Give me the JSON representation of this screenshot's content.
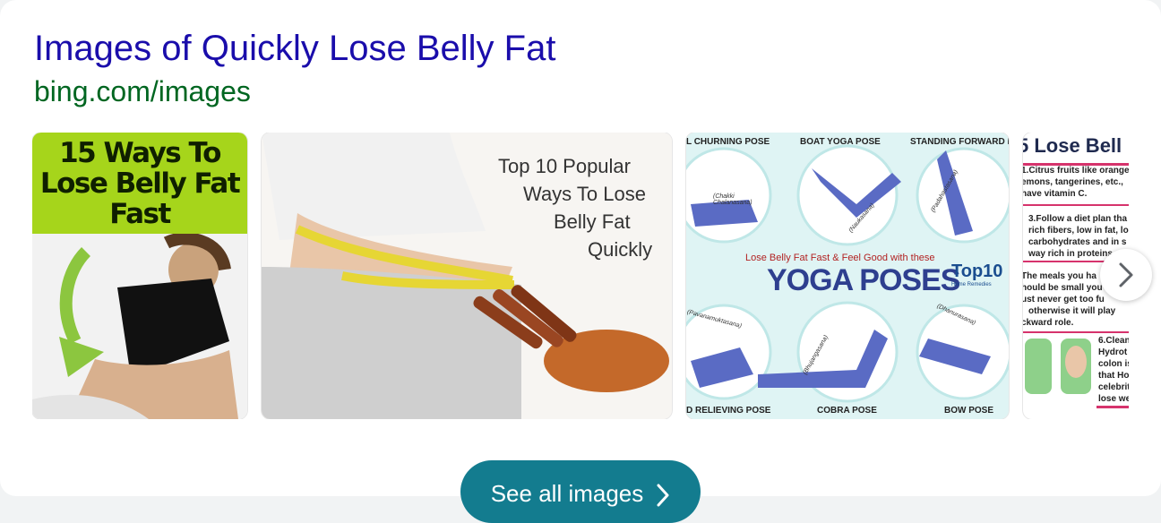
{
  "header": {
    "title": "Images of Quickly Lose Belly Fat",
    "url": "bing.com/images"
  },
  "thumbnails": [
    {
      "lines": [
        "15 Ways To",
        "Lose Belly Fat",
        "Fast"
      ]
    },
    {
      "lines": [
        "Top 10 Popular",
        "Ways To Lose",
        "Belly Fat",
        "Quickly"
      ]
    },
    {
      "top_labels": [
        "L CHURNING POSE",
        "BOAT YOGA POSE",
        "STANDING FORWARD BE"
      ],
      "pose_names": [
        "(Chakki Chalanasana)",
        "(Naukasana)",
        "(Padahastasana)",
        "(Pavanamuktasana)",
        "(Bhujangasana)",
        "(Dhanurasana)"
      ],
      "subtitle": "Lose Belly Fat Fast & Feel Good with these",
      "main_text": "YOGA POSES",
      "brand": "Top10",
      "brand_sub": "Home Remedies",
      "bottom_labels": [
        "D RELIEVING POSE",
        "COBRA POSE",
        "BOW POSE"
      ]
    },
    {
      "title": "5 Lose Bell",
      "lines": [
        "1.Citrus fruits like orange",
        "emons, tangerines, etc.,",
        "have vitamin C.",
        "3.Follow a diet plan tha",
        "rich fibers, low in fat, lo",
        "carbohydrates and in s",
        "way rich in proteins",
        "The meals you ha",
        "hould be small you",
        "ust never get too fu",
        "otherwise it will play",
        "ckward role.",
        "6.Clean",
        "Hydrot",
        "colon is",
        "that Ho",
        "celebrit",
        "lose we"
      ]
    }
  ],
  "controls": {
    "next_icon": "chevron-right-icon",
    "see_all_label": "See all images",
    "see_all_icon": "chevron-right-icon"
  },
  "colors": {
    "title": "#1a0dab",
    "url": "#006621",
    "button": "#137c8f"
  }
}
